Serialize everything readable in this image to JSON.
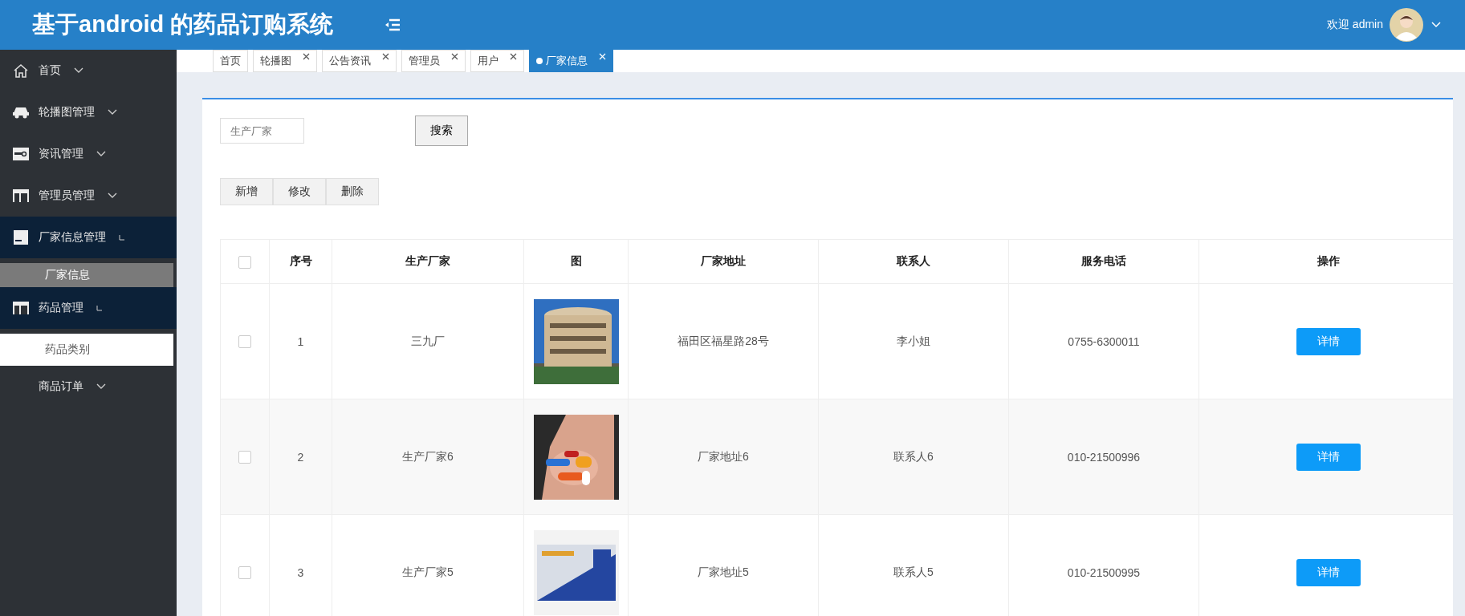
{
  "header": {
    "title": "基于android 的药品订购系统",
    "welcome": "欢迎 admin"
  },
  "sidebar": {
    "items": [
      {
        "label": "首页",
        "expanded": false
      },
      {
        "label": "轮播图管理",
        "expanded": false
      },
      {
        "label": "资讯管理",
        "expanded": false
      },
      {
        "label": "管理员管理",
        "expanded": false
      },
      {
        "label": "厂家信息管理",
        "expanded": true,
        "children": [
          {
            "label": "厂家信息",
            "selected": true,
            "hovered": false
          }
        ]
      },
      {
        "label": "药品管理",
        "expanded": true,
        "children": [
          {
            "label": "药品类别",
            "selected": false,
            "hovered": true
          }
        ]
      },
      {
        "label": "商品订单",
        "expanded": false
      }
    ]
  },
  "tabs": [
    {
      "label": "首页",
      "selected": false,
      "closable": false
    },
    {
      "label": "轮播图",
      "selected": false,
      "closable": true
    },
    {
      "label": "公告资讯",
      "selected": false,
      "closable": true
    },
    {
      "label": "管理员",
      "selected": false,
      "closable": true
    },
    {
      "label": "用户",
      "selected": false,
      "closable": true
    },
    {
      "label": "厂家信息",
      "selected": true,
      "closable": true
    }
  ],
  "search": {
    "placeholder": "生产厂家",
    "button": "搜索"
  },
  "actions": [
    "新增",
    "修改",
    "删除"
  ],
  "table": {
    "columns": [
      "序号",
      "生产厂家",
      "图",
      "厂家地址",
      "联系人",
      "服务电话",
      "操作"
    ],
    "header_checked": false,
    "rows": [
      {
        "checked": false,
        "index": "1",
        "name": "三九厂",
        "address": "福田区福星路28号",
        "contact": "李小姐",
        "phone": "0755-6300011",
        "action": "详情"
      },
      {
        "checked": false,
        "index": "2",
        "name": "生产厂家6",
        "address": "厂家地址6",
        "contact": "联系人6",
        "phone": "010-21500996",
        "action": "详情"
      },
      {
        "checked": false,
        "index": "3",
        "name": "生产厂家5",
        "address": "厂家地址5",
        "contact": "联系人5",
        "phone": "010-21500995",
        "action": "详情"
      }
    ]
  }
}
